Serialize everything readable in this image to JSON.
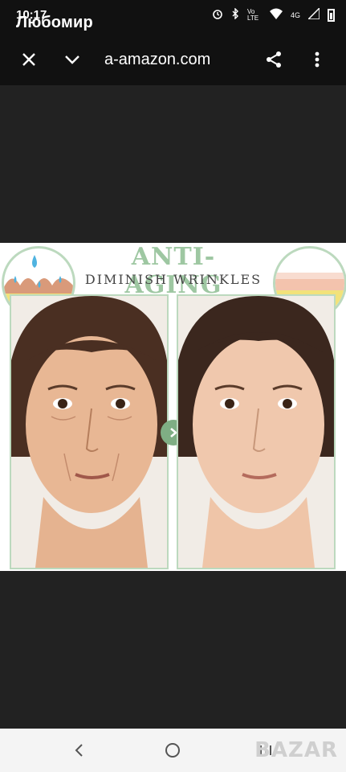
{
  "status_bar": {
    "time": "10:17",
    "user": "Любомир",
    "network": "4G",
    "volte": "Vo LTE"
  },
  "toolbar": {
    "url": "a-amazon.com"
  },
  "ad": {
    "headline": "ANTI-AGING",
    "subheadline": "DIMINISH WRINKLES"
  },
  "watermark": "BAZAR"
}
